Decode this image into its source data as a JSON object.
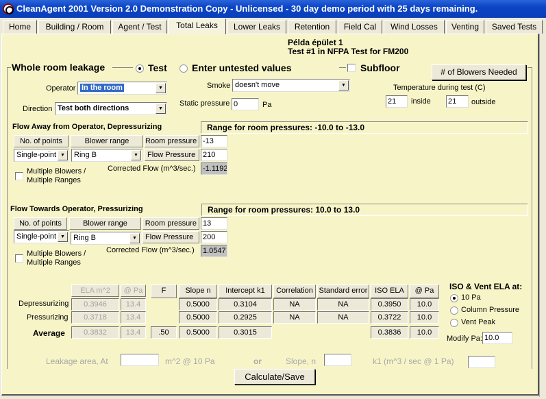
{
  "window": {
    "title": "CleanAgent 2001   Version 2.0  Demonstration Copy - Unlicensed - 30 day demo period with 25 days remaining."
  },
  "tabs": [
    {
      "label": "Home",
      "active": false
    },
    {
      "label": "Building / Room",
      "active": false
    },
    {
      "label": "Agent / Test",
      "active": false
    },
    {
      "label": "Total Leaks",
      "active": true
    },
    {
      "label": "Lower Leaks",
      "active": false
    },
    {
      "label": "Retention",
      "active": false
    },
    {
      "label": "Field Cal",
      "active": false
    },
    {
      "label": "Wind Losses",
      "active": false
    },
    {
      "label": "Venting",
      "active": false
    },
    {
      "label": "Saved Tests",
      "active": false
    }
  ],
  "header": {
    "building": "Példa épület 1",
    "test": "Test #1 in NFPA Test for FM200"
  },
  "whole_room": {
    "legend": "Whole room leakage",
    "radio_test": "Test",
    "radio_untested": "Enter untested values",
    "selected": "Test",
    "subfloor_label": "Subfloor",
    "subfloor_checked": false,
    "blowers_button": "# of Blowers Needed",
    "operator_label": "Operator",
    "operator_value": "In the room",
    "direction_label": "Direction",
    "direction_value": "Test both directions",
    "smoke_label": "Smoke",
    "smoke_value": "doesn't move",
    "static_label": "Static pressure",
    "static_value": "0",
    "static_unit": "Pa",
    "temp_label": "Temperature during test (C)",
    "temp_inside": "21",
    "temp_inside_label": "inside",
    "temp_outside": "21",
    "temp_outside_label": "outside"
  },
  "depress": {
    "title": "Flow Away from Operator, Depressurizing",
    "range": "Range for room pressures:  -10.0 to -13.0",
    "col_points": "No. of points",
    "col_blower": "Blower range",
    "room_pressure_label": "Room pressure",
    "room_pressure": "-13",
    "points_value": "Single-point",
    "blower_value": "Ring B",
    "flow_pressure_label": "Flow Pressure",
    "flow_pressure": "210",
    "corrected_label": "Corrected Flow (m^3/sec.)",
    "corrected": "-1.1192",
    "multi_label1": "Multiple Blowers /",
    "multi_label2": "Multiple Ranges"
  },
  "press": {
    "title": "Flow Towards Operator, Pressurizing",
    "range": "Range for room pressures:  10.0 to 13.0",
    "col_points": "No. of points",
    "col_blower": "Blower range",
    "room_pressure_label": "Room pressure",
    "room_pressure": "13",
    "points_value": "Single-point",
    "blower_value": "Ring B",
    "flow_pressure_label": "Flow Pressure",
    "flow_pressure": "200",
    "corrected_label": "Corrected Flow (m^3/sec.)",
    "corrected": "1.0547",
    "multi_label1": "Multiple Blowers /",
    "multi_label2": "Multiple Ranges"
  },
  "results": {
    "headers": {
      "ela": "ELA m^2",
      "at_pa": "@ Pa",
      "f": "F",
      "slope": "Slope n",
      "intercept": "Intercept k1",
      "corr": "Correlation",
      "stderr": "Standard error",
      "iso": "ISO ELA",
      "iso_pa": "@ Pa"
    },
    "rows": [
      {
        "label": "Depressurizing",
        "ela": "0.3946",
        "at_pa": "13.4",
        "f": "",
        "slope": "0.5000",
        "intercept": "0.3104",
        "corr": "NA",
        "stderr": "NA",
        "iso": "0.3950",
        "iso_pa": "10.0"
      },
      {
        "label": "Pressurizing",
        "ela": "0.3718",
        "at_pa": "13.4",
        "f": "",
        "slope": "0.5000",
        "intercept": "0.2925",
        "corr": "NA",
        "stderr": "NA",
        "iso": "0.3722",
        "iso_pa": "10.0"
      },
      {
        "label": "Average",
        "ela": "0.3832",
        "at_pa": "13.4",
        "f": ".50",
        "slope": "0.5000",
        "intercept": "0.3015",
        "corr": "",
        "stderr": "",
        "iso": "0.3836",
        "iso_pa": "10.0"
      }
    ]
  },
  "iso_vent": {
    "title": "ISO & Vent ELA at:",
    "options": [
      "10 Pa",
      "Column Pressure",
      "Vent Peak"
    ],
    "selected": "10 Pa",
    "modify_label": "Modify Pa:",
    "modify_value": "10.0"
  },
  "untested": {
    "leak_label": "Leakage area, At",
    "leak_value": "",
    "leak_unit": "m^2 @ 10 Pa",
    "or": "or",
    "slope_label": "Slope, n",
    "slope_value": "",
    "k1_label": "k1 (m^3 / sec @ 1 Pa)",
    "k1_value": ""
  },
  "calc_button": "Calculate/Save"
}
